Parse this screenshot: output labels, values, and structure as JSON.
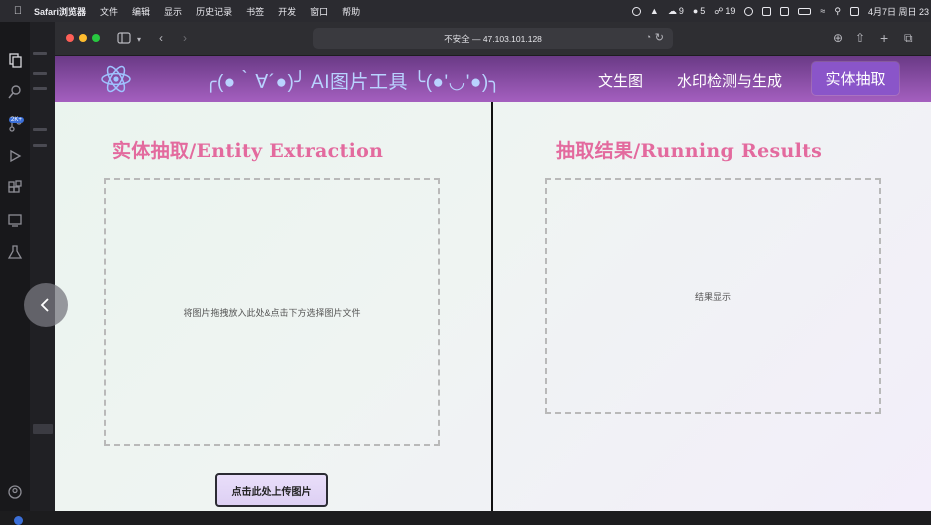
{
  "menubar": {
    "app": "Safari浏览器",
    "items": [
      "文件",
      "编辑",
      "显示",
      "历史记录",
      "书签",
      "开发",
      "窗口",
      "帮助"
    ],
    "status": {
      "s1": "9",
      "s2": "5",
      "s3": "19",
      "clock": "4月7日 周日 23"
    }
  },
  "browser": {
    "url_text": "不安全 — 47.103.101.128"
  },
  "site": {
    "title": "╭(●｀∀´●)╯ AI图片工具 ╰(●'◡'●)╮",
    "nav_links": [
      "文生图",
      "水印检测与生成"
    ],
    "nav_active": "实体抽取"
  },
  "left_panel": {
    "title": "实体抽取/Entity Extraction",
    "dropzone_text": "将图片拖拽放入此处&点击下方选择图片文件",
    "upload_button": "点击此处上传图片"
  },
  "right_panel": {
    "title": "抽取结果/Running Results",
    "result_text": "结果显示"
  }
}
